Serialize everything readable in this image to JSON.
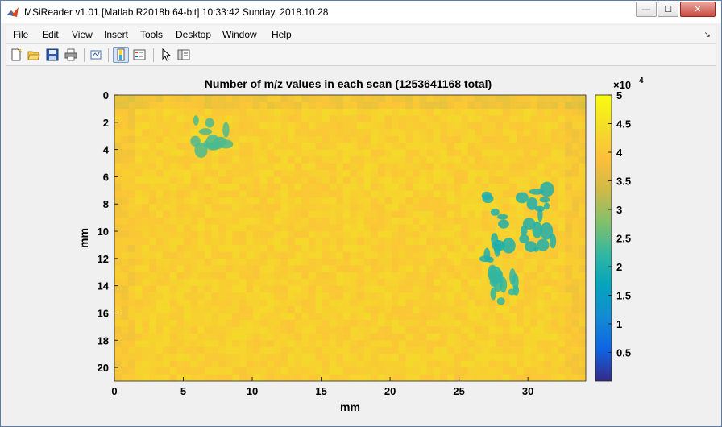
{
  "window": {
    "title": "MSiReader  v1.01  [Matlab R2018b 64-bit]  10:33:42 Sunday, 2018.10.28",
    "minimize_glyph": "—",
    "maximize_glyph": "☐",
    "close_glyph": "✕"
  },
  "menu": {
    "items": [
      "File",
      "Edit",
      "View",
      "Insert",
      "Tools",
      "Desktop",
      "Window",
      "Help"
    ],
    "dock_arrow": "↘"
  },
  "toolbar": {
    "icons": [
      "new-figure-icon",
      "open-file-icon",
      "save-icon",
      "print-icon",
      "link-plot-icon",
      "colorbar-toggle-icon",
      "legend-icon",
      "edit-plot-arrow-icon",
      "property-inspector-icon"
    ]
  },
  "colors": {
    "titlebar": "#ffffff",
    "background": "#f0f0f0",
    "close_button": "#c94b3f"
  },
  "chart_data": {
    "type": "heatmap",
    "title": "Number of m/z values in each scan (1253641168 total)",
    "xlabel": "mm",
    "ylabel": "mm",
    "xlim": [
      0,
      34.2
    ],
    "ylim": [
      21,
      0
    ],
    "x_ticks": [
      0,
      5,
      10,
      15,
      20,
      25,
      30
    ],
    "y_ticks": [
      0,
      2,
      4,
      6,
      8,
      10,
      12,
      14,
      16,
      18,
      20
    ],
    "x_tick_labels": [
      "0",
      "5",
      "10",
      "15",
      "20",
      "25",
      "30"
    ],
    "y_tick_labels": [
      "0",
      "2",
      "4",
      "6",
      "8",
      "10",
      "12",
      "14",
      "16",
      "18",
      "20"
    ],
    "colorbar": {
      "range": [
        0,
        50000
      ],
      "multiplier_label": "×10",
      "multiplier_exponent": "4",
      "ticks": [
        0.5,
        1,
        1.5,
        2,
        2.5,
        3,
        3.5,
        4,
        4.5,
        5
      ],
      "tick_labels": [
        "0.5",
        "1",
        "1.5",
        "2",
        "2.5",
        "3",
        "3.5",
        "4",
        "4.5",
        "5"
      ],
      "colormap": "parula"
    },
    "background_level": 42000,
    "regions": [
      {
        "name": "upper-left arc",
        "x": 7,
        "y": 3,
        "value": 24000
      },
      {
        "name": "right cluster",
        "x": 29.5,
        "y": 9.5,
        "value": 20000
      },
      {
        "name": "lower right spots",
        "x": 28.5,
        "y": 14,
        "value": 22000
      }
    ]
  }
}
